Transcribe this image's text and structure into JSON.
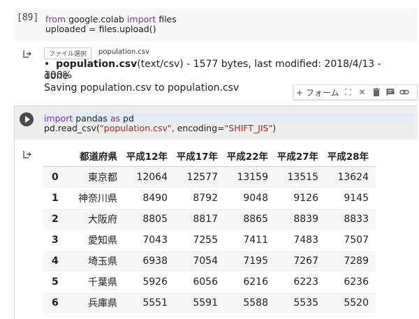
{
  "cell1": {
    "exec_count": "[89]",
    "code_line1": {
      "kw1": "from",
      "mid": " google.colab ",
      "kw2": "import",
      "tail": " files"
    },
    "code_line2": "uploaded = files.upload()"
  },
  "output1": {
    "file_button": "ファイル選択",
    "file_name": "population.csv",
    "upload_bold": "population.csv",
    "upload_detail": "(text/csv) - 1577 bytes, last modified: 2018/4/13 - 100%",
    "done": "done",
    "saving": "Saving population.csv to population.csv"
  },
  "toolbar": {
    "form_label": "+ フォーム",
    "icons": [
      "expand-icon",
      "close-icon",
      "trash-icon",
      "comment-icon",
      "link-icon"
    ]
  },
  "cell2": {
    "line1": {
      "kw1": "import",
      "mid": " pandas ",
      "kw2": "as",
      "tail": " pd"
    },
    "line2": {
      "pre": "pd.read_csv(",
      "str1": "\"population.csv\"",
      "mid": ", encoding=",
      "str2": "\"SHIFT_JIS\"",
      "post": ")"
    }
  },
  "table": {
    "columns": [
      "",
      "都道府県",
      "平成12年",
      "平成17年",
      "平成22年",
      "平成27年",
      "平成28年"
    ],
    "rows": [
      [
        "0",
        "東京都",
        "12064",
        "12577",
        "13159",
        "13515",
        "13624"
      ],
      [
        "1",
        "神奈川県",
        "8490",
        "8792",
        "9048",
        "9126",
        "9145"
      ],
      [
        "2",
        "大阪府",
        "8805",
        "8817",
        "8865",
        "8839",
        "8833"
      ],
      [
        "3",
        "愛知県",
        "7043",
        "7255",
        "7411",
        "7483",
        "7507"
      ],
      [
        "4",
        "埼玉県",
        "6938",
        "7054",
        "7195",
        "7267",
        "7289"
      ],
      [
        "5",
        "千葉県",
        "5926",
        "6056",
        "6216",
        "6223",
        "6236"
      ],
      [
        "6",
        "兵庫県",
        "5551",
        "5591",
        "5588",
        "5535",
        "5520"
      ]
    ]
  }
}
